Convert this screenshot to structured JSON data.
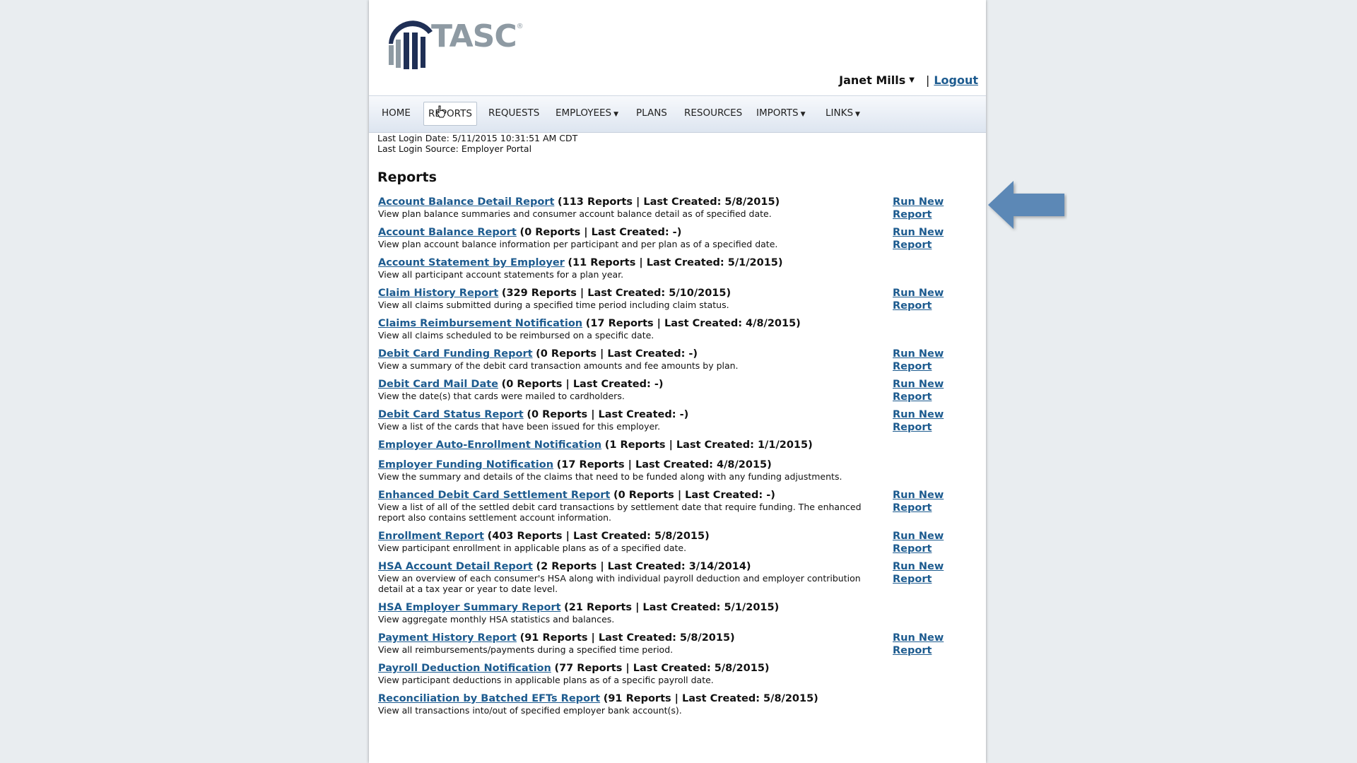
{
  "brand": {
    "name": "TASC",
    "reg": "®"
  },
  "user": {
    "name": "Janet Mills",
    "separator": "|",
    "logout": "Logout"
  },
  "nav": [
    {
      "label": "HOME",
      "dropdown": false,
      "active": false
    },
    {
      "label": "REPORTS",
      "dropdown": false,
      "active": true
    },
    {
      "label": "REQUESTS",
      "dropdown": false,
      "active": false
    },
    {
      "label": "EMPLOYEES",
      "dropdown": true,
      "active": false
    },
    {
      "label": "PLANS",
      "dropdown": false,
      "active": false
    },
    {
      "label": "RESOURCES",
      "dropdown": false,
      "active": false
    },
    {
      "label": "IMPORTS",
      "dropdown": true,
      "active": false
    },
    {
      "label": "LINKS",
      "dropdown": true,
      "active": false
    }
  ],
  "login": {
    "date": "Last Login Date: 5/11/2015 10:31:51 AM CDT",
    "source": "Last Login Source: Employer Portal"
  },
  "page_title": "Reports",
  "run_label": "Run New Report",
  "reports": [
    {
      "name": "Account Balance Detail Report",
      "meta": "(113 Reports | Last Created: 5/8/2015)",
      "desc": "View plan balance summaries and consumer account balance detail as of specified date.",
      "run": true
    },
    {
      "name": "Account Balance Report",
      "meta": "(0 Reports | Last Created: -)",
      "desc": "View plan account balance information per participant and per plan as of a specified date.",
      "run": true
    },
    {
      "name": "Account Statement by Employer",
      "meta": "(11 Reports | Last Created: 5/1/2015)",
      "desc": "View all participant account statements for a plan year.",
      "run": false
    },
    {
      "name": "Claim History Report",
      "meta": "(329 Reports | Last Created: 5/10/2015)",
      "desc": "View all claims submitted during a specified time period including claim status.",
      "run": true
    },
    {
      "name": "Claims Reimbursement Notification",
      "meta": "(17 Reports | Last Created: 4/8/2015)",
      "desc": "View all claims scheduled to be reimbursed on a specific date.",
      "run": false
    },
    {
      "name": "Debit Card Funding Report",
      "meta": "(0 Reports | Last Created: -)",
      "desc": "View a summary of the debit card transaction amounts and fee amounts by plan.",
      "run": true
    },
    {
      "name": "Debit Card Mail Date",
      "meta": "(0 Reports | Last Created: -)",
      "desc": "View the date(s) that cards were mailed to cardholders.",
      "run": true
    },
    {
      "name": "Debit Card Status Report",
      "meta": "(0 Reports | Last Created: -)",
      "desc": "View a list of the cards that have been issued for this employer.",
      "run": true
    },
    {
      "name": "Employer Auto-Enrollment Notification",
      "meta": "(1 Reports | Last Created: 1/1/2015)",
      "desc": "",
      "run": false
    },
    {
      "name": "Employer Funding Notification",
      "meta": "(17 Reports | Last Created: 4/8/2015)",
      "desc": "View the summary and details of the claims that need to be funded along with any funding adjustments.",
      "run": false
    },
    {
      "name": "Enhanced Debit Card Settlement Report",
      "meta": "(0 Reports | Last Created: -)",
      "desc": "View a list of all of the settled debit card transactions by settlement date that require funding. The enhanced report also contains settlement account information.",
      "run": true
    },
    {
      "name": "Enrollment Report",
      "meta": "(403 Reports | Last Created: 5/8/2015)",
      "desc": "View participant enrollment in applicable plans as of a specified date.",
      "run": true
    },
    {
      "name": "HSA Account Detail Report",
      "meta": "(2 Reports | Last Created: 3/14/2014)",
      "desc": "View an overview of each consumer's HSA along with individual payroll deduction and employer contribution detail at a tax year or year to date level.",
      "run": true
    },
    {
      "name": "HSA Employer Summary Report",
      "meta": "(21 Reports | Last Created: 5/1/2015)",
      "desc": "View aggregate monthly HSA statistics and balances.",
      "run": false
    },
    {
      "name": "Payment History Report",
      "meta": "(91 Reports | Last Created: 5/8/2015)",
      "desc": "View all reimbursements/payments during a specified time period.",
      "run": true
    },
    {
      "name": "Payroll Deduction Notification",
      "meta": "(77 Reports | Last Created: 5/8/2015)",
      "desc": "View participant deductions in applicable plans as of a specific payroll date.",
      "run": false
    },
    {
      "name": "Reconciliation by Batched EFTs Report",
      "meta": "(91 Reports | Last Created: 5/8/2015)",
      "desc": "View all transactions into/out of specified employer bank account(s).",
      "run": false
    }
  ],
  "colors": {
    "link": "#1d5b8f",
    "arrow": "#5b88b6",
    "logo_navy": "#1f2f55",
    "logo_gray": "#8e9aa3"
  }
}
